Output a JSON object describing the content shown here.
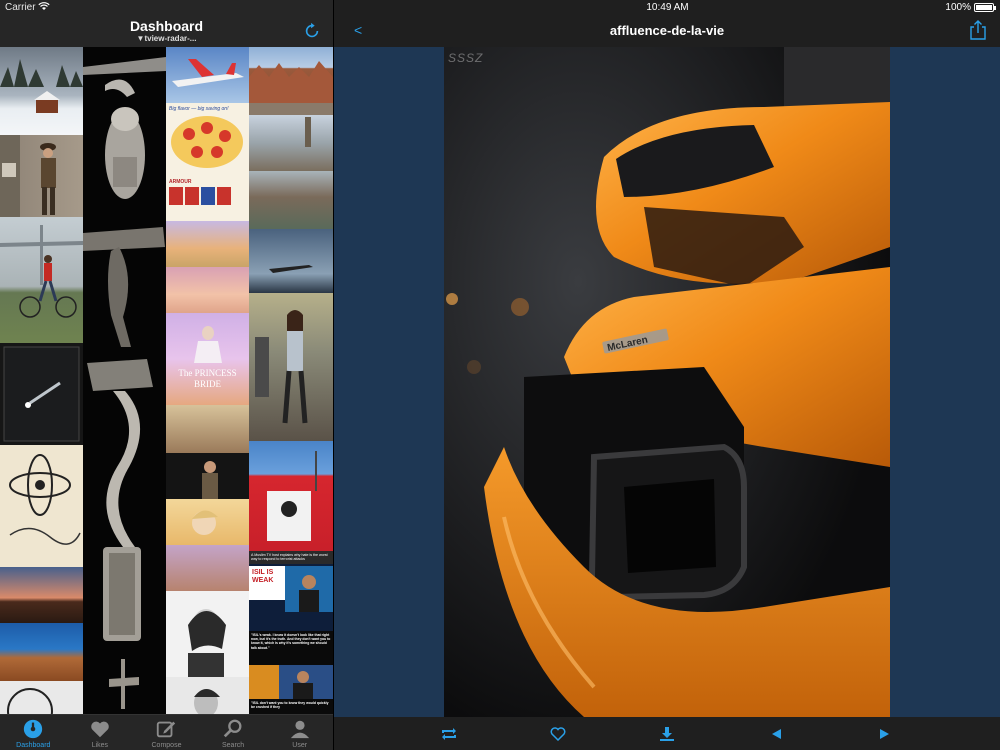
{
  "status": {
    "carrier": "Carrier",
    "time": "10:49 AM",
    "battery": "100%"
  },
  "left": {
    "title": "Dashboard",
    "subtitle": "▼tview-radar-...",
    "tabs": [
      {
        "label": "Dashboard",
        "icon": "gauge-icon",
        "active": true
      },
      {
        "label": "Likes",
        "icon": "heart-icon",
        "active": false
      },
      {
        "label": "Compose",
        "icon": "compose-icon",
        "active": false
      },
      {
        "label": "Search",
        "icon": "search-icon",
        "active": false
      },
      {
        "label": "User",
        "icon": "user-icon",
        "active": false
      }
    ]
  },
  "right": {
    "back": "<",
    "title": "affluence-de-la-vie",
    "watermark": "SSSZ",
    "badge": "McLaren"
  },
  "thumbs": {
    "ad_title": "Big flavor — big saving on!",
    "ad_brand": "ARMOUR",
    "princess": "The PRINCESS BRIDE",
    "news1": "A Muslim TV host explains why hate is the worst way to respond to terrorist attacks",
    "isil": "ISIL IS WEAK",
    "quote1": "\"ISIL's weak. I know it doesn't look like that right now, but it's the truth. And they don't want you to know it, which is why it's something we should talk about.\"",
    "quote2": "\"ISIL don't want you to know they would quickly be crushed if they"
  },
  "colors": {
    "accent": "#2aa0e8",
    "background_right": "#1e3754",
    "car_orange": "#f08a18"
  }
}
